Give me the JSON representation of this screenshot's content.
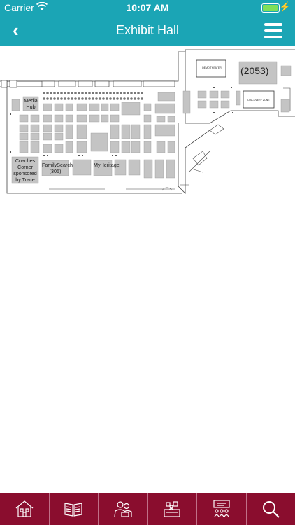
{
  "status": {
    "carrier": "Carrier",
    "time": "10:07 AM",
    "battery_level": 0.95
  },
  "header": {
    "title": "Exhibit Hall",
    "back_icon": "chevron-left-icon",
    "menu_icon": "hamburger-menu-icon"
  },
  "map": {
    "labels": {
      "demo_theater": "DEMO THEATER",
      "booth_2053": "(2053)",
      "discovery_zone": "DISCOVERY ZONE",
      "media_hub": "Media Hub",
      "coaches_corner": "Coaches Corner sponsored by Trace",
      "familysearch": "FamilySearch (305)",
      "myheritage": "MyHeritage"
    }
  },
  "tabs": [
    {
      "name": "home",
      "icon": "house-icon"
    },
    {
      "name": "program",
      "icon": "book-icon"
    },
    {
      "name": "speakers",
      "icon": "speakers-icon"
    },
    {
      "name": "exhibitors",
      "icon": "exhibit-booth-icon"
    },
    {
      "name": "sessions",
      "icon": "meeting-icon"
    },
    {
      "name": "search",
      "icon": "search-icon"
    }
  ],
  "colors": {
    "brand_teal": "#1ba5b5",
    "tab_maroon": "#8a0d2e"
  }
}
